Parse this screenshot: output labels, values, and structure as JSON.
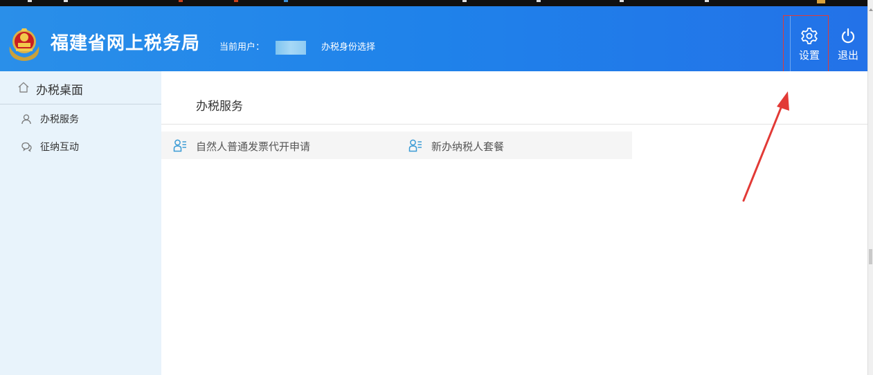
{
  "header": {
    "site_title": "福建省网上税务局",
    "current_user_label": "当前用户：",
    "identity_select_label": "办税身份选择",
    "settings_label": "设置",
    "logout_label": "退出",
    "settings_icon": "gear-icon",
    "logout_icon": "power-icon",
    "emblem_icon": "tax-emblem-icon"
  },
  "sidebar": {
    "home": {
      "label": "办税桌面",
      "icon": "home-icon"
    },
    "items": [
      {
        "label": "办税服务",
        "icon": "user-icon"
      },
      {
        "label": "征纳互动",
        "icon": "chat-icon"
      }
    ]
  },
  "main": {
    "section_title": "办税服务",
    "services": [
      {
        "label": "自然人普通发票代开申请",
        "icon": "user-list-icon"
      },
      {
        "label": "新办纳税人套餐",
        "icon": "user-list-icon"
      }
    ]
  },
  "colors": {
    "header_gradient_start": "#2a8fe9",
    "header_gradient_end": "#2372e8",
    "sidebar_bg": "#e8f3fb",
    "annotation_red": "#e23a36",
    "service_icon": "#3a9bd5"
  }
}
